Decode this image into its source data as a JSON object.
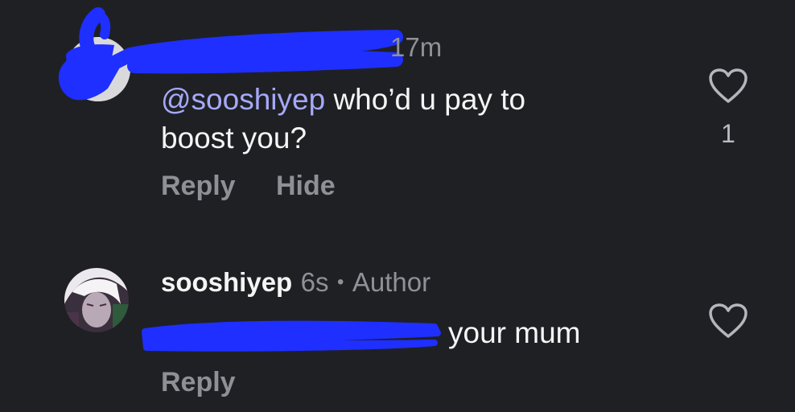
{
  "comment1": {
    "time": "17m",
    "mention": "@sooshiyep",
    "text_line1": " who’d u pay to",
    "text_line2": "boost you?",
    "reply_label": "Reply",
    "hide_label": "Hide",
    "like_count": "1"
  },
  "comment2": {
    "username": "sooshiyep",
    "time": "6s",
    "separator": "•",
    "author_badge": "Author",
    "text": "your mum",
    "reply_label": "Reply"
  },
  "colors": {
    "background": "#1f2024",
    "mention": "#a6a9f8",
    "scribble": "#1f2fff",
    "muted_text": "#8f9196"
  },
  "icons": {
    "like": "heart-outline-icon"
  }
}
